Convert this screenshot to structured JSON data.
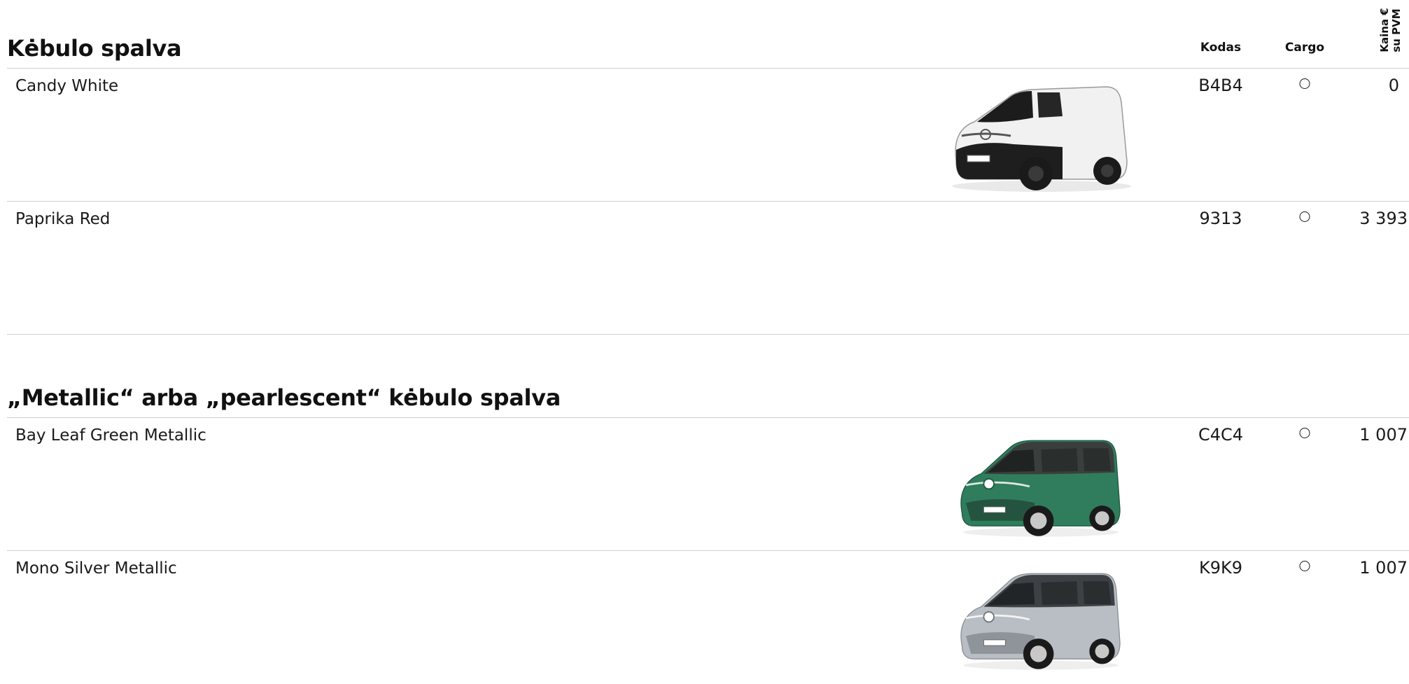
{
  "headers": {
    "kodas": "Kodas",
    "cargo": "Cargo",
    "kaina_line1": "Kaina €",
    "kaina_line2": "su PVM"
  },
  "sections": [
    {
      "title": "Kėbulo spalva",
      "rows": [
        {
          "name": "Candy White",
          "code": "B4B4",
          "cargo": "○",
          "price": "0",
          "image": "van-white-cargo-icon",
          "body_color": "#f2f2f2"
        },
        {
          "name": "Paprika Red",
          "code": "9313",
          "cargo": "○",
          "price": "3 393",
          "image": null
        }
      ]
    },
    {
      "title": "„Metallic“ arba „pearlescent“ kėbulo spalva",
      "rows": [
        {
          "name": "Bay Leaf Green Metallic",
          "code": "C4C4",
          "cargo": "○",
          "price": "1 007",
          "image": "van-green-icon",
          "body_color": "#2f7d5c"
        },
        {
          "name": "Mono Silver Metallic",
          "code": "K9K9",
          "cargo": "○",
          "price": "1 007",
          "image": "van-silver-icon",
          "body_color": "#b9bec4"
        }
      ]
    }
  ]
}
